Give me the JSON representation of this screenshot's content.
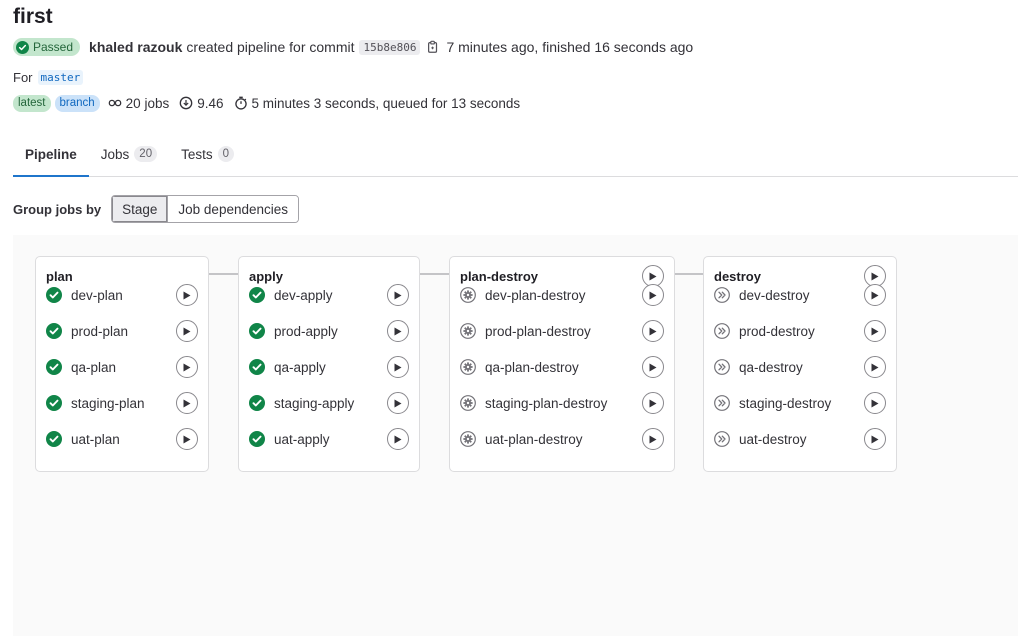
{
  "pipeline": {
    "title": "first",
    "status": "Passed",
    "author": "khaled razouk",
    "created_text": "created pipeline for commit",
    "commit_sha": "15b8e806",
    "time_text": "7 minutes ago, finished 16 seconds ago",
    "for_label": "For",
    "ref": "master",
    "badges": [
      "latest",
      "branch"
    ],
    "jobs_count": "20 jobs",
    "score": "9.46",
    "duration": "5 minutes 3 seconds, queued for 13 seconds"
  },
  "tabs": [
    {
      "label": "Pipeline",
      "count": ""
    },
    {
      "label": "Jobs",
      "count": "20"
    },
    {
      "label": "Tests",
      "count": "0"
    }
  ],
  "group_by": {
    "label": "Group jobs by",
    "options": [
      "Stage",
      "Job dependencies"
    ],
    "selected": "Stage"
  },
  "colors": {
    "success": "#108548",
    "manual": "#737278",
    "skipped": "#737278",
    "accent": "#1f75cb"
  },
  "stages": [
    {
      "name": "plan",
      "jobs": [
        {
          "name": "dev-plan",
          "status": "success"
        },
        {
          "name": "prod-plan",
          "status": "success"
        },
        {
          "name": "qa-plan",
          "status": "success"
        },
        {
          "name": "staging-plan",
          "status": "success"
        },
        {
          "name": "uat-plan",
          "status": "success"
        }
      ]
    },
    {
      "name": "apply",
      "jobs": [
        {
          "name": "dev-apply",
          "status": "success"
        },
        {
          "name": "prod-apply",
          "status": "success"
        },
        {
          "name": "qa-apply",
          "status": "success"
        },
        {
          "name": "staging-apply",
          "status": "success"
        },
        {
          "name": "uat-apply",
          "status": "success"
        }
      ]
    },
    {
      "name": "plan-destroy",
      "jobs": [
        {
          "name": "dev-plan-destroy",
          "status": "manual"
        },
        {
          "name": "prod-plan-destroy",
          "status": "manual"
        },
        {
          "name": "qa-plan-destroy",
          "status": "manual"
        },
        {
          "name": "staging-plan-destroy",
          "status": "manual"
        },
        {
          "name": "uat-plan-destroy",
          "status": "manual"
        }
      ]
    },
    {
      "name": "destroy",
      "jobs": [
        {
          "name": "dev-destroy",
          "status": "skipped"
        },
        {
          "name": "prod-destroy",
          "status": "skipped"
        },
        {
          "name": "qa-destroy",
          "status": "skipped"
        },
        {
          "name": "staging-destroy",
          "status": "skipped"
        },
        {
          "name": "uat-destroy",
          "status": "skipped"
        }
      ]
    }
  ]
}
